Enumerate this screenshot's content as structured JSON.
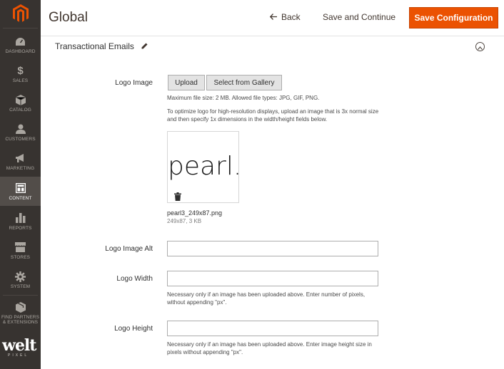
{
  "sidebar": {
    "items": [
      {
        "label": "DASHBOARD",
        "icon": "speedometer-icon"
      },
      {
        "label": "SALES",
        "icon": "dollar-icon"
      },
      {
        "label": "CATALOG",
        "icon": "cube-icon"
      },
      {
        "label": "CUSTOMERS",
        "icon": "person-icon"
      },
      {
        "label": "MARKETING",
        "icon": "megaphone-icon"
      },
      {
        "label": "CONTENT",
        "icon": "layout-icon"
      },
      {
        "label": "REPORTS",
        "icon": "bar-chart-icon"
      },
      {
        "label": "STORES",
        "icon": "storefront-icon"
      },
      {
        "label": "SYSTEM",
        "icon": "gear-icon"
      },
      {
        "label": "FIND PARTNERS & EXTENSIONS",
        "icon": "box-icon"
      }
    ],
    "active": "CONTENT",
    "brand_main": "welt",
    "brand_sub": "PIXEL"
  },
  "header": {
    "title": "Global",
    "back_label": "Back",
    "save_continue_label": "Save and Continue",
    "save_config_label": "Save Configuration",
    "accent": "#eb5202"
  },
  "section": {
    "title": "Transactional Emails"
  },
  "form": {
    "logo_image_label": "Logo Image",
    "upload_label": "Upload",
    "gallery_label": "Select from Gallery",
    "file_size_note": "Maximum file size: 2 MB. Allowed file types: JPG, GIF, PNG.",
    "optimize_note": "To optimize logo for high-resolution displays, upload an image that is 3x normal size and then specify 1x dimensions in the width/height fields below.",
    "preview_text": "pearl.",
    "file_name": "pearl3_249x87.png",
    "file_meta": "249x87, 3 KB",
    "logo_alt_label": "Logo Image Alt",
    "logo_alt_value": "",
    "logo_width_label": "Logo Width",
    "logo_width_value": "",
    "logo_width_note": "Necessary only if an image has been uploaded above. Enter number of pixels, without appending \"px\".",
    "logo_height_label": "Logo Height",
    "logo_height_value": "",
    "logo_height_note": "Necessary only if an image has been uploaded above. Enter image height size in pixels without appending \"px\"."
  }
}
